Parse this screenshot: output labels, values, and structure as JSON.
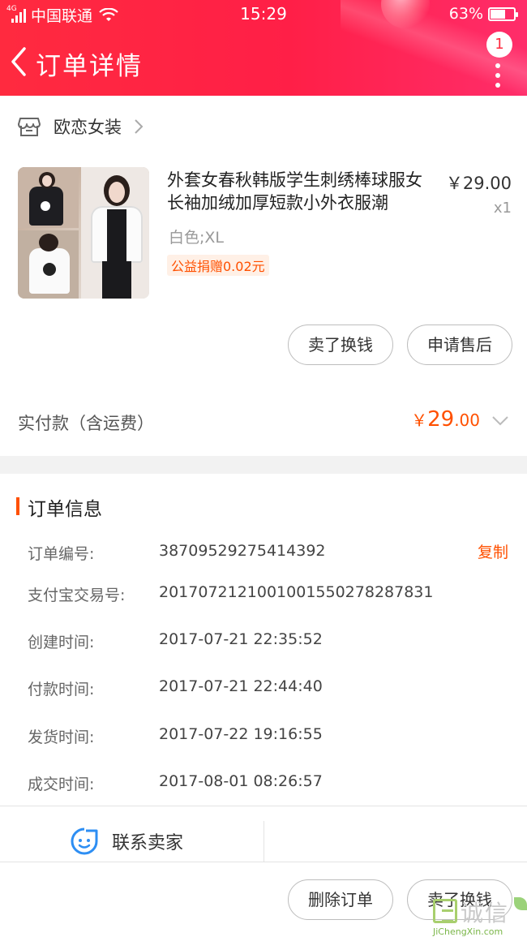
{
  "status_bar": {
    "network": "4G",
    "carrier": "中国联通",
    "time": "15:29",
    "battery": "63%",
    "battery_level": 0.63
  },
  "nav": {
    "title": "订单详情",
    "badge_count": "1",
    "back_icon": "chevron-left-icon",
    "more_icon": "more-vertical-icon"
  },
  "shop": {
    "name": "欧恋女装",
    "icon": "store-icon"
  },
  "product": {
    "title": "外套女春秋韩版学生刺绣棒球服女长袖加绒加厚短款小外衣服潮",
    "price": "￥29.00",
    "quantity": "x1",
    "spec": "白色;XL",
    "charity": "公益捐赠0.02元",
    "actions": {
      "sell_back": "卖了换钱",
      "after_sale": "申请售后"
    }
  },
  "payment": {
    "label": "实付款（含运费）",
    "currency": "￥",
    "amount_int": "29",
    "amount_dec": ".00"
  },
  "order_info": {
    "title": "订单信息",
    "copy_label": "复制",
    "rows": [
      {
        "label": "订单编号:",
        "value": "38709529275414392"
      },
      {
        "label": "支付宝交易号:",
        "value": "2017072121001001550278287831"
      },
      {
        "label": "创建时间:",
        "value": "2017-07-21 22:35:52"
      },
      {
        "label": "付款时间:",
        "value": "2017-07-21 22:44:40"
      },
      {
        "label": "发货时间:",
        "value": "2017-07-22 19:16:55"
      },
      {
        "label": "成交时间:",
        "value": "2017-08-01 08:26:57"
      }
    ]
  },
  "contact": {
    "label": "联系卖家",
    "icon": "chat-face-icon"
  },
  "bottom_actions": {
    "delete_order": "删除订单",
    "sell_back": "卖了换钱"
  },
  "watermark": {
    "text": "诚信",
    "domain": "JiChengXin.com"
  },
  "colors": {
    "header_red": "#ff2a3f",
    "accent_orange": "#ff5000",
    "divider_gray": "#f2f2f2"
  }
}
